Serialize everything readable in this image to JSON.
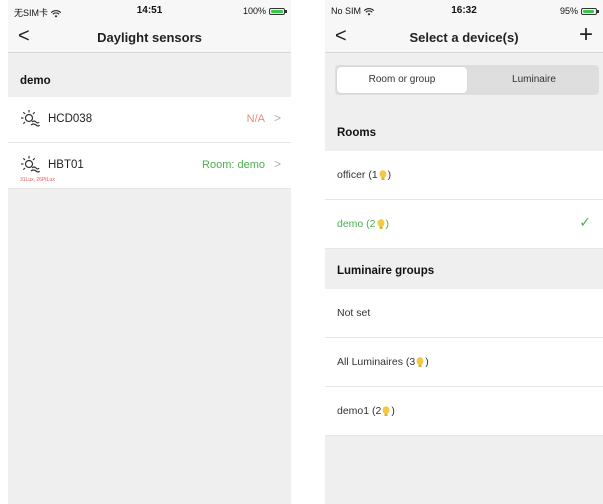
{
  "left": {
    "status": {
      "carrier": "无SIM卡",
      "time": "14:51",
      "battery": "100%",
      "battery_level": 100
    },
    "nav": {
      "back": "<",
      "title": "Daylight sensors"
    },
    "section": "demo",
    "sensors": [
      {
        "name": "HCD038",
        "status": "N/A",
        "lux": ""
      },
      {
        "name": "HBT01",
        "status": "Room: demo",
        "lux": "31Lux, 26PtLux"
      }
    ]
  },
  "right": {
    "status": {
      "carrier": "No SIM",
      "time": "16:32",
      "battery": "95%",
      "battery_level": 95
    },
    "nav": {
      "back": "<",
      "title": "Select a device(s)",
      "add": "+"
    },
    "tabs": [
      "Room or group",
      "Luminaire"
    ],
    "rooms_header": "Rooms",
    "rooms": [
      {
        "prefix": "officer (1",
        "suffix": ")"
      },
      {
        "prefix": "demo (2",
        "suffix": ")",
        "selected": true
      }
    ],
    "groups_header": "Luminaire groups",
    "groups": [
      {
        "prefix": "Not set",
        "suffix": ""
      },
      {
        "prefix": "All Luminaires (3",
        "suffix": ")"
      },
      {
        "prefix": "demo1 (2",
        "suffix": ")"
      }
    ],
    "check": "✓"
  },
  "colors": {
    "accent_green": "#4caf50",
    "na_red": "#f08a7a",
    "bulb_yellow": "#f5c842"
  }
}
